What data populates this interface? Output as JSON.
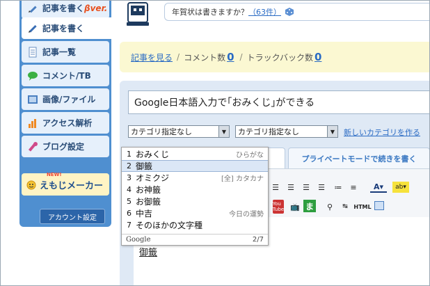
{
  "sidebar": {
    "items": [
      {
        "label": "記事を書く",
        "suffix": "βver.",
        "icon": "pencil-icon"
      },
      {
        "label": "記事を書く",
        "icon": "pencil-icon",
        "active": true
      },
      {
        "label": "記事一覧",
        "icon": "document-icon"
      },
      {
        "label": "コメント/TB",
        "icon": "speech-bubble-icon"
      },
      {
        "label": "画像/ファイル",
        "icon": "image-icon"
      },
      {
        "label": "アクセス解析",
        "icon": "bar-chart-icon"
      },
      {
        "label": "ブログ設定",
        "icon": "wrench-icon"
      }
    ],
    "emoji_maker": {
      "badge": "NEW!",
      "label": "えもじメーカー"
    },
    "account_settings": "アカウント設定"
  },
  "header": {
    "question": "年賀状は書きますか？",
    "count_link": "（63件）"
  },
  "info_bar": {
    "view_article": "記事を見る",
    "separator": "/",
    "comment_label": "コメント数",
    "comment_count": "0",
    "trackback_label": "トラックバック数",
    "trackback_count": "0"
  },
  "editor": {
    "title_value": "Google日本語入力で｢おみくじ｣ができる",
    "category1": "カテゴリ指定なし",
    "category2": "カテゴリ指定なし",
    "new_category": "新しいカテゴリを作る",
    "private_mode_tab": "プライベートモードで続きを書く",
    "body_text": "御籤"
  },
  "ime": {
    "candidates": [
      {
        "num": "1",
        "text": "おみくじ",
        "note": "ひらがな"
      },
      {
        "num": "2",
        "text": "御籤",
        "note": ""
      },
      {
        "num": "3",
        "text": "オミクジ",
        "note": "[全] カタカナ"
      },
      {
        "num": "4",
        "text": "お神籤",
        "note": ""
      },
      {
        "num": "5",
        "text": "お御籤",
        "note": ""
      },
      {
        "num": "6",
        "text": "中吉",
        "note": "今日の運勢"
      },
      {
        "num": "7",
        "text": "そのほかの文字種",
        "note": ""
      }
    ],
    "selected_index": 1,
    "brand": "Google",
    "page": "2/7"
  },
  "toolbar": {
    "youtube_label": "You Tube",
    "ma_label": "ま",
    "html_label": "HTML"
  },
  "colors": {
    "sidebar": "#4f8fd0",
    "link": "#2a6bc4",
    "info_bar": "#fbf8d2",
    "panel": "#dfe9f5"
  }
}
